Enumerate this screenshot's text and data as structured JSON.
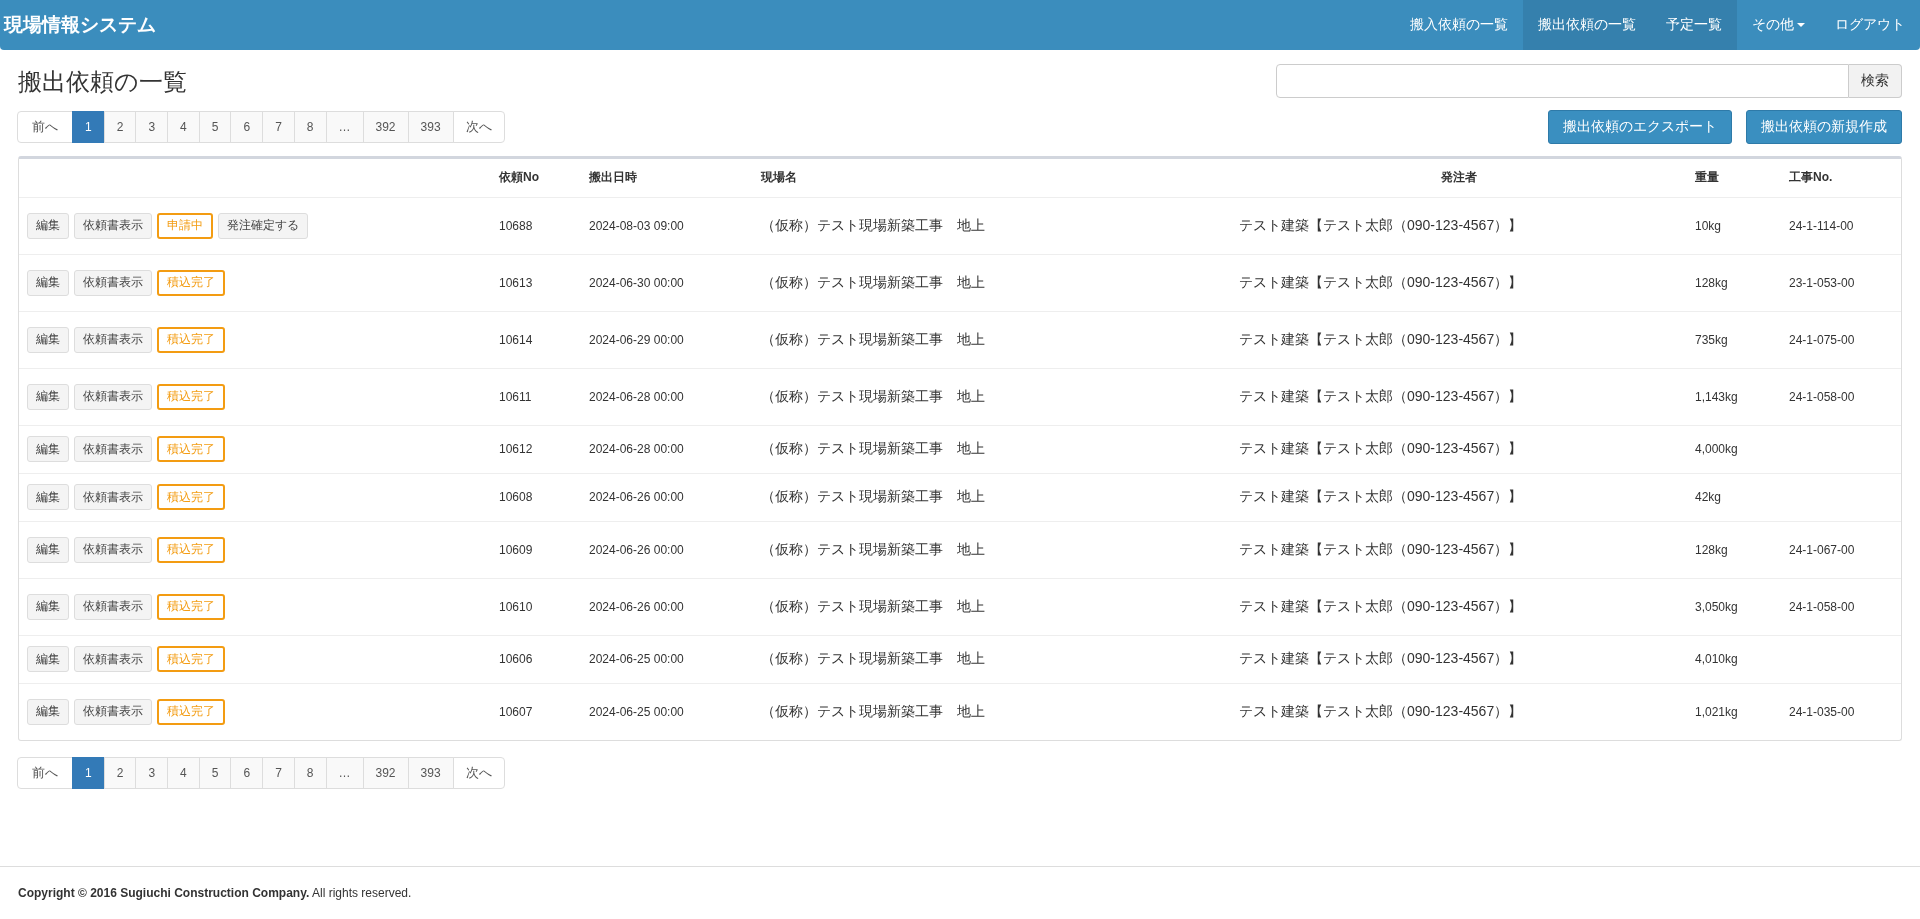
{
  "navbar": {
    "brand": "現場情報システム",
    "items": [
      {
        "label": "搬入依頼の一覧",
        "kind": "link",
        "selected": false
      },
      {
        "label": "搬出依頼の一覧",
        "kind": "link",
        "selected": true
      },
      {
        "label": "予定一覧",
        "kind": "link",
        "selected": true
      },
      {
        "label": "その他",
        "kind": "dropdown",
        "selected": false
      },
      {
        "label": "ログアウト",
        "kind": "link",
        "selected": false
      }
    ]
  },
  "page_title": "搬出依頼の一覧",
  "search": {
    "button": "検索"
  },
  "pagination_top": [
    {
      "label": "前へ",
      "selected": false
    },
    {
      "label": "1",
      "selected": true
    },
    {
      "label": "2",
      "selected": false
    },
    {
      "label": "3",
      "selected": false
    },
    {
      "label": "4",
      "selected": false
    },
    {
      "label": "5",
      "selected": false
    },
    {
      "label": "6",
      "selected": false
    },
    {
      "label": "7",
      "selected": false
    },
    {
      "label": "8",
      "selected": false
    },
    {
      "label": "…",
      "selected": false
    },
    {
      "label": "392",
      "selected": false
    },
    {
      "label": "393",
      "selected": false
    },
    {
      "label": "次へ",
      "selected": false
    }
  ],
  "actions": [
    "搬出依頼のエクスポート",
    "搬出依頼の新規作成"
  ],
  "table": {
    "columns": [
      "",
      "依頼No",
      "搬出日時",
      "現場名",
      "発注者",
      "重量",
      "工事No."
    ],
    "rows": [
      {
        "buttons": [
          {
            "label": "編集",
            "kind": "default"
          },
          {
            "label": "依頼書表示",
            "kind": "default"
          },
          {
            "label": "申請中",
            "kind": "warning"
          },
          {
            "label": "発注確定する",
            "kind": "default"
          }
        ],
        "no": "10688",
        "date": "2024-08-03 09:00",
        "site": "（仮称）テスト現場新築工事　地上",
        "orderer": "テスト建築【テスト太郎（090-123-4567）】",
        "weight": "10kg",
        "koji": "24-1-114-00"
      },
      {
        "buttons": [
          {
            "label": "編集",
            "kind": "default"
          },
          {
            "label": "依頼書表示",
            "kind": "default"
          },
          {
            "label": "積込完了",
            "kind": "warning"
          }
        ],
        "no": "10613",
        "date": "2024-06-30 00:00",
        "site": "（仮称）テスト現場新築工事　地上",
        "orderer": "テスト建築【テスト太郎（090-123-4567）】",
        "weight": "128kg",
        "koji": "23-1-053-00"
      },
      {
        "buttons": [
          {
            "label": "編集",
            "kind": "default"
          },
          {
            "label": "依頼書表示",
            "kind": "default"
          },
          {
            "label": "積込完了",
            "kind": "warning"
          }
        ],
        "no": "10614",
        "date": "2024-06-29 00:00",
        "site": "（仮称）テスト現場新築工事　地上",
        "orderer": "テスト建築【テスト太郎（090-123-4567）】",
        "weight": "735kg",
        "koji": "24-1-075-00"
      },
      {
        "buttons": [
          {
            "label": "編集",
            "kind": "default"
          },
          {
            "label": "依頼書表示",
            "kind": "default"
          },
          {
            "label": "積込完了",
            "kind": "warning"
          }
        ],
        "no": "10611",
        "date": "2024-06-28 00:00",
        "site": "（仮称）テスト現場新築工事　地上",
        "orderer": "テスト建築【テスト太郎（090-123-4567）】",
        "weight": "1,143kg",
        "koji": "24-1-058-00"
      },
      {
        "buttons": [
          {
            "label": "編集",
            "kind": "default"
          },
          {
            "label": "依頼書表示",
            "kind": "default"
          },
          {
            "label": "積込完了",
            "kind": "warning"
          }
        ],
        "no": "10612",
        "date": "2024-06-28 00:00",
        "site": "（仮称）テスト現場新築工事　地上",
        "orderer": "テスト建築【テスト太郎（090-123-4567）】",
        "weight": "4,000kg"
      },
      {
        "buttons": [
          {
            "label": "編集",
            "kind": "default"
          },
          {
            "label": "依頼書表示",
            "kind": "default"
          },
          {
            "label": "積込完了",
            "kind": "warning"
          }
        ],
        "no": "10608",
        "date": "2024-06-26 00:00",
        "site": "（仮称）テスト現場新築工事　地上",
        "orderer": "テスト建築【テスト太郎（090-123-4567）】",
        "weight": "42kg"
      },
      {
        "buttons": [
          {
            "label": "編集",
            "kind": "default"
          },
          {
            "label": "依頼書表示",
            "kind": "default"
          },
          {
            "label": "積込完了",
            "kind": "warning"
          }
        ],
        "no": "10609",
        "date": "2024-06-26 00:00",
        "site": "（仮称）テスト現場新築工事　地上",
        "orderer": "テスト建築【テスト太郎（090-123-4567）】",
        "weight": "128kg",
        "koji": "24-1-067-00"
      },
      {
        "buttons": [
          {
            "label": "編集",
            "kind": "default"
          },
          {
            "label": "依頼書表示",
            "kind": "default"
          },
          {
            "label": "積込完了",
            "kind": "warning"
          }
        ],
        "no": "10610",
        "date": "2024-06-26 00:00",
        "site": "（仮称）テスト現場新築工事　地上",
        "orderer": "テスト建築【テスト太郎（090-123-4567）】",
        "weight": "3,050kg",
        "koji": "24-1-058-00"
      },
      {
        "buttons": [
          {
            "label": "編集",
            "kind": "default"
          },
          {
            "label": "依頼書表示",
            "kind": "default"
          },
          {
            "label": "積込完了",
            "kind": "warning"
          }
        ],
        "no": "10606",
        "date": "2024-06-25 00:00",
        "site": "（仮称）テスト現場新築工事　地上",
        "orderer": "テスト建築【テスト太郎（090-123-4567）】",
        "weight": "4,010kg"
      },
      {
        "buttons": [
          {
            "label": "編集",
            "kind": "default"
          },
          {
            "label": "依頼書表示",
            "kind": "default"
          },
          {
            "label": "積込完了",
            "kind": "warning"
          }
        ],
        "no": "10607",
        "date": "2024-06-25 00:00",
        "site": "（仮称）テスト現場新築工事　地上",
        "orderer": "テスト建築【テスト太郎（090-123-4567）】",
        "weight": "1,021kg",
        "koji": "24-1-035-00"
      }
    ]
  },
  "pagination_bottom": [
    {
      "label": "前へ",
      "selected": false
    },
    {
      "label": "1",
      "selected": true
    },
    {
      "label": "2",
      "selected": false
    },
    {
      "label": "3",
      "selected": false
    },
    {
      "label": "4",
      "selected": false
    },
    {
      "label": "5",
      "selected": false
    },
    {
      "label": "6",
      "selected": false
    },
    {
      "label": "7",
      "selected": false
    },
    {
      "label": "8",
      "selected": false
    },
    {
      "label": "…",
      "selected": false
    },
    {
      "label": "392",
      "selected": false
    },
    {
      "label": "393",
      "selected": false
    },
    {
      "label": "次へ",
      "selected": false
    }
  ],
  "footer": "**Copyright © 2016  Sugiuchi Construction Company.** All rights reserved."
}
